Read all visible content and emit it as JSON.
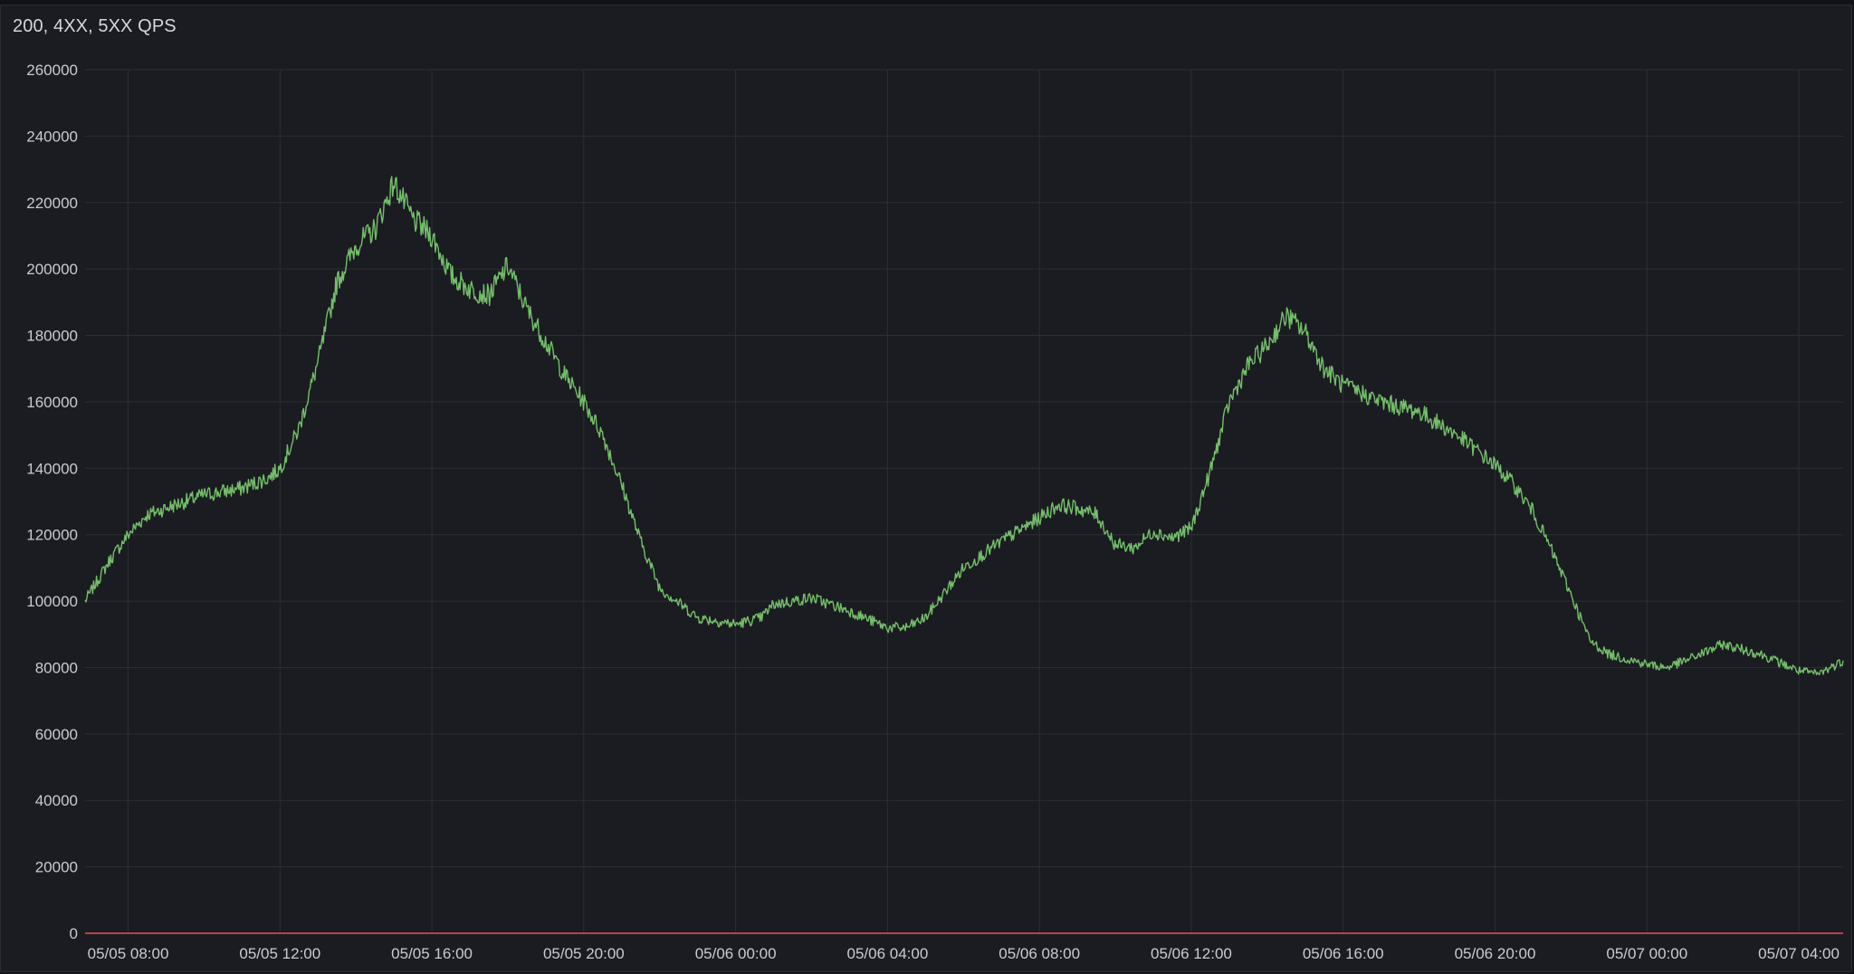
{
  "panel": {
    "title": "200, 4XX, 5XX QPS"
  },
  "colors": {
    "background": "#1b1c21",
    "grid": "#2c2e35",
    "series": "#73bf69",
    "threshold": "#f2495c",
    "text": "#c9cbd2"
  },
  "chart_data": {
    "type": "line",
    "title": "200, 4XX, 5XX QPS",
    "xlabel": "",
    "ylabel": "",
    "ylim": [
      0,
      260000
    ],
    "xlim": [
      "05/05 06:52",
      "05/07 05:10"
    ],
    "y_ticks": [
      "0",
      "20000",
      "40000",
      "60000",
      "80000",
      "100000",
      "120000",
      "140000",
      "160000",
      "180000",
      "200000",
      "220000",
      "240000",
      "260000"
    ],
    "x_ticks": [
      "05/05 08:00",
      "05/05 12:00",
      "05/05 16:00",
      "05/05 20:00",
      "05/06 00:00",
      "05/06 04:00",
      "05/06 08:00",
      "05/06 12:00",
      "05/06 16:00",
      "05/06 20:00",
      "05/07 00:00",
      "05/07 04:00"
    ],
    "grid": true,
    "legend": "none",
    "series": [
      {
        "x": [
          "05/05 06:52",
          "05/05 07:30",
          "05/05 08:00",
          "05/05 08:30",
          "05/05 09:00",
          "05/05 10:00",
          "05/05 11:00",
          "05/05 11:40",
          "05/05 12:00",
          "05/05 12:30",
          "05/05 13:00",
          "05/05 13:30",
          "05/05 14:00",
          "05/05 14:30",
          "05/05 15:00",
          "05/05 15:30",
          "05/05 16:00",
          "05/05 16:30",
          "05/05 17:00",
          "05/05 17:30",
          "05/05 18:00",
          "05/05 18:30",
          "05/05 19:00",
          "05/05 19:30",
          "05/05 20:00",
          "05/05 20:30",
          "05/05 21:00",
          "05/05 21:30",
          "05/05 22:00",
          "05/05 23:00",
          "05/06 00:00",
          "05/06 00:40",
          "05/06 01:00",
          "05/06 02:00",
          "05/06 03:00",
          "05/06 04:00",
          "05/06 04:30",
          "05/06 05:00",
          "05/06 06:00",
          "05/06 07:00",
          "05/06 08:00",
          "05/06 08:30",
          "05/06 09:00",
          "05/06 09:30",
          "05/06 10:00",
          "05/06 10:30",
          "05/06 11:00",
          "05/06 11:30",
          "05/06 12:00",
          "05/06 12:30",
          "05/06 13:00",
          "05/06 13:30",
          "05/06 14:00",
          "05/06 14:30",
          "05/06 15:00",
          "05/06 15:30",
          "05/06 16:00",
          "05/06 17:00",
          "05/06 18:00",
          "05/06 19:00",
          "05/06 20:00",
          "05/06 20:30",
          "05/06 21:00",
          "05/06 21:30",
          "05/06 22:00",
          "05/06 22:30",
          "05/06 23:00",
          "05/07 00:00",
          "05/07 00:30",
          "05/07 01:00",
          "05/07 02:00",
          "05/07 03:00",
          "05/07 04:00",
          "05/07 04:30",
          "05/07 05:10"
        ],
        "values": [
          100000,
          112000,
          120000,
          126000,
          128000,
          132000,
          134000,
          137000,
          140000,
          152000,
          172000,
          196000,
          207000,
          212000,
          226000,
          215000,
          210000,
          198000,
          194000,
          192000,
          201000,
          188000,
          178000,
          168000,
          160000,
          150000,
          135000,
          118000,
          104000,
          95000,
          93000,
          95000,
          99000,
          101000,
          97000,
          92000,
          92000,
          95000,
          110000,
          118000,
          125000,
          129000,
          128000,
          126000,
          117000,
          116000,
          121000,
          119000,
          122000,
          139000,
          160000,
          171000,
          177000,
          186000,
          181000,
          170000,
          165000,
          160000,
          157000,
          150000,
          141000,
          135000,
          127000,
          115000,
          102000,
          88000,
          84000,
          81000,
          80000,
          82000,
          87000,
          84000,
          79000,
          78000,
          82000
        ]
      },
      {
        "x": [
          "05/05 06:52",
          "05/07 05:10"
        ],
        "values": [
          0,
          0
        ]
      }
    ]
  }
}
